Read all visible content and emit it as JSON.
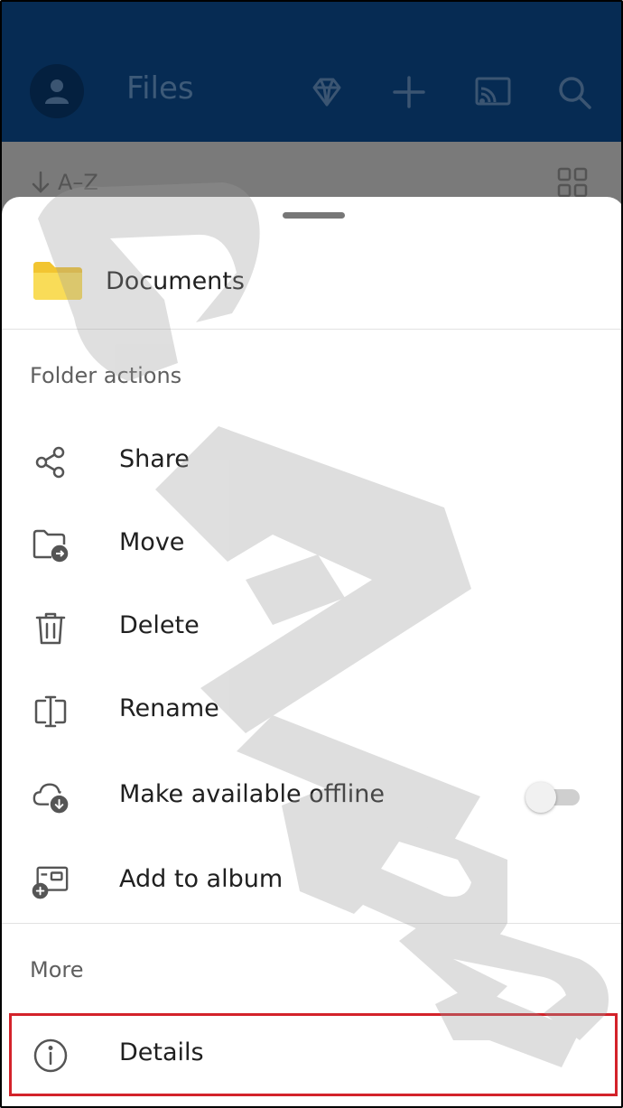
{
  "appbar": {
    "title": "Files",
    "icons": [
      "account-icon",
      "premium-diamond-icon",
      "add-icon",
      "cast-icon",
      "search-icon"
    ]
  },
  "toolbar": {
    "sort_label": "A–Z",
    "sort_icon": "arrow-down-icon",
    "view_icon": "grid-view-icon"
  },
  "sheet": {
    "folder_name": "Documents",
    "folder_color": "#f7d23c",
    "folder_actions_label": "Folder actions",
    "actions": [
      {
        "label": "Share",
        "icon": "share-icon"
      },
      {
        "label": "Move",
        "icon": "move-folder-icon"
      },
      {
        "label": "Delete",
        "icon": "trash-icon"
      },
      {
        "label": "Rename",
        "icon": "rename-icon"
      },
      {
        "label": "Make available offline",
        "icon": "cloud-download-icon",
        "toggle": false
      },
      {
        "label": "Add to album",
        "icon": "add-to-album-icon"
      }
    ],
    "more_label": "More",
    "more_actions": [
      {
        "label": "Details",
        "icon": "info-icon"
      }
    ]
  },
  "colors": {
    "appbar_bg": "#062b53",
    "highlight": "#d3222a"
  }
}
